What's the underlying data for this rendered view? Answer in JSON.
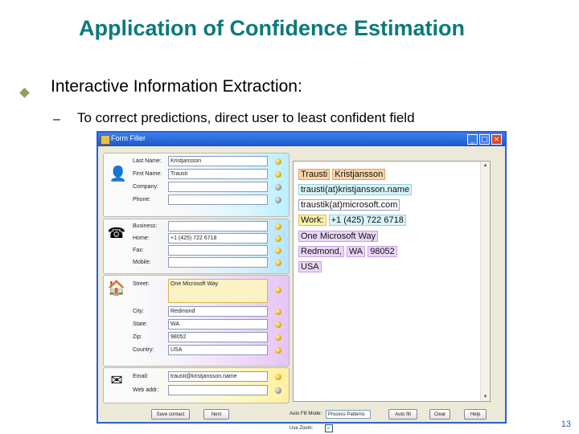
{
  "slide": {
    "title": "Application of Confidence Estimation",
    "bullet": "Interactive Information Extraction:",
    "sub_bullet": "To correct predictions, direct user to least confident field",
    "page_number": "13"
  },
  "window": {
    "title": "Form Filler",
    "buttons": {
      "minimize": "_",
      "maximize": "□",
      "close": "×"
    }
  },
  "form": {
    "name_group": {
      "icon": "user-icon",
      "fields": [
        {
          "label": "Last Name:",
          "value": "Kristjansson"
        },
        {
          "label": "First Name:",
          "value": "Trausti"
        },
        {
          "label": "Company:",
          "value": ""
        },
        {
          "label": "Phone:",
          "value": ""
        }
      ]
    },
    "phone_group": {
      "icon": "telephone-icon",
      "fields": [
        {
          "label": "Business:",
          "value": ""
        },
        {
          "label": "Home:",
          "value": "+1 (425) 722 6718"
        },
        {
          "label": "Fax:",
          "value": ""
        },
        {
          "label": "Mobile:",
          "value": ""
        }
      ]
    },
    "address_group": {
      "icon": "house-icon",
      "fields": [
        {
          "label": "Street:",
          "value": "One Microsoft Way"
        },
        {
          "label": "City:",
          "value": "Redmond"
        },
        {
          "label": "State:",
          "value": "WA"
        },
        {
          "label": "Zip:",
          "value": "98052"
        },
        {
          "label": "Country:",
          "value": "USA"
        }
      ]
    },
    "web_group": {
      "icon": "email-icon",
      "fields": [
        {
          "label": "Email:",
          "value": "trausti@kristjansson.name"
        },
        {
          "label": "Web addr:",
          "value": ""
        }
      ]
    }
  },
  "source_text": {
    "lines": [
      [
        "Trausti",
        "Kristjansson"
      ],
      [
        "trausti(at)kristjansson.name"
      ],
      [
        "traustik(at)microsoft.com"
      ],
      [
        "Work:",
        "+1 (425) 722 6718"
      ],
      [
        "One Microsoft Way"
      ],
      [
        "Redmond,",
        "WA",
        "98052"
      ],
      [
        "USA"
      ]
    ]
  },
  "bottom": {
    "save_contact": "Save contact",
    "next": "Next",
    "auto_fill_mode_label": "Auto Fill Mode:",
    "auto_fill_mode_value": "Process Patterns",
    "auto_fill": "Auto fill",
    "clear": "Clear",
    "help": "Help",
    "use_zoom_label": "Use Zoom:",
    "use_zoom_checked": "✓"
  }
}
